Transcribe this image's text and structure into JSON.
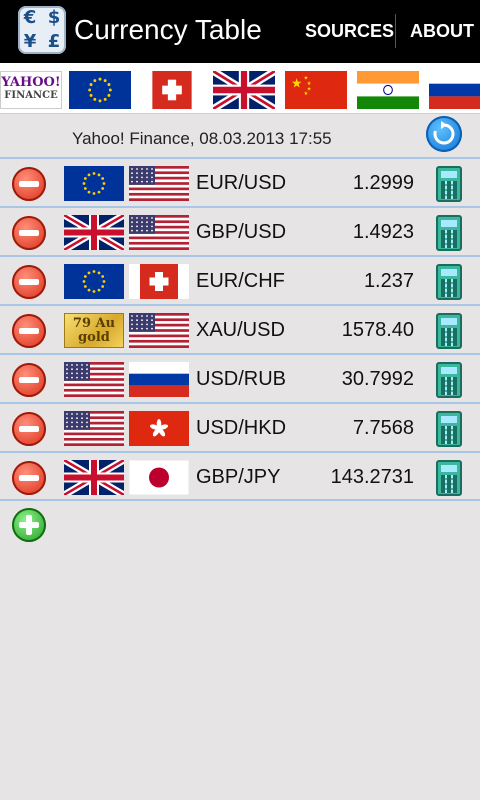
{
  "app": {
    "title": "Currency Table",
    "icon": "currency-symbols-icon"
  },
  "actions": {
    "sources": "SOURCES",
    "about": "ABOUT"
  },
  "sources": [
    {
      "name": "yahoo-finance",
      "label_top": "YAHOO!",
      "label_bottom": "FINANCE"
    },
    {
      "name": "eu"
    },
    {
      "name": "ch"
    },
    {
      "name": "gb"
    },
    {
      "name": "cn"
    },
    {
      "name": "in"
    },
    {
      "name": "ru"
    }
  ],
  "status": {
    "text": "Yahoo! Finance, 08.03.2013 17:55"
  },
  "rows": [
    {
      "pair": "EUR/USD",
      "rate": "1.2999",
      "from": "eu",
      "to": "us"
    },
    {
      "pair": "GBP/USD",
      "rate": "1.4923",
      "from": "gb",
      "to": "us"
    },
    {
      "pair": "EUR/CHF",
      "rate": "1.237",
      "from": "eu",
      "to": "ch"
    },
    {
      "pair": "XAU/USD",
      "rate": "1578.40",
      "from": "gold",
      "to": "us"
    },
    {
      "pair": "USD/RUB",
      "rate": "30.7992",
      "from": "us",
      "to": "ru"
    },
    {
      "pair": "USD/HKD",
      "rate": "7.7568",
      "from": "us",
      "to": "hk"
    },
    {
      "pair": "GBP/JPY",
      "rate": "143.2731",
      "from": "gb",
      "to": "jp"
    }
  ],
  "gold": {
    "line1": "79 Au",
    "line2": "gold"
  },
  "colors": {
    "actionbar": "#000000",
    "background": "#e7e4e6",
    "divider": "#a8c6e6"
  }
}
